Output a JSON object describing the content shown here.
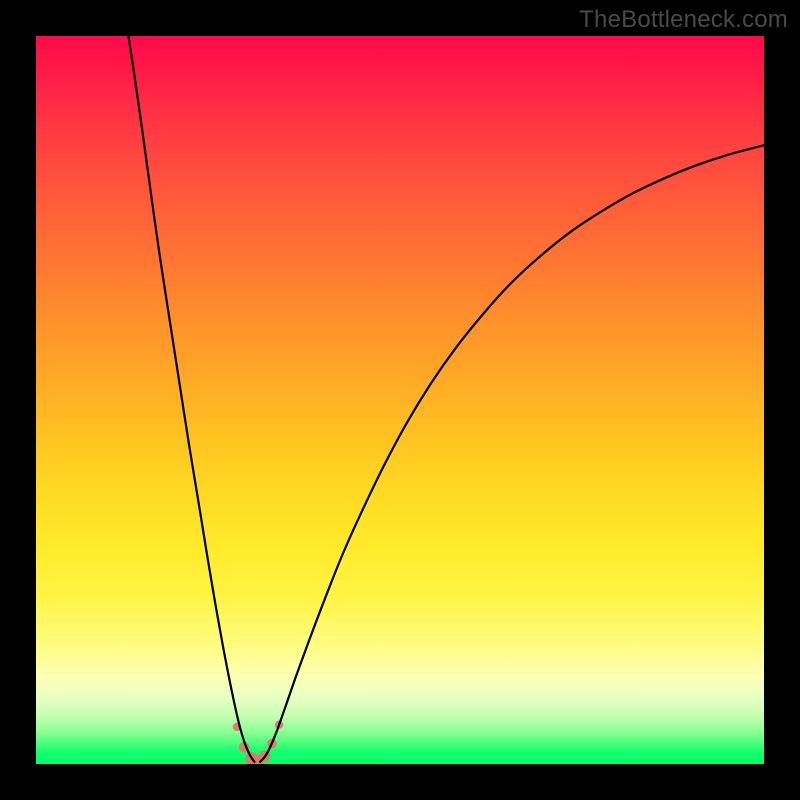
{
  "watermark": "TheBottleneck.com",
  "colors": {
    "frame": "#000000",
    "curve_stroke": "#000000",
    "marker_fill": "#e57368",
    "marker_stroke": "#e57368"
  },
  "chart_data": {
    "type": "line",
    "title": "",
    "xlabel": "",
    "ylabel": "",
    "xlim": [
      0,
      100
    ],
    "ylim": [
      0,
      100
    ],
    "grid": false,
    "legend": false,
    "curve_left": {
      "description": "steep descending arc from near top-left to valley",
      "points": [
        {
          "x": 12.7,
          "y": 100.0
        },
        {
          "x": 13.6,
          "y": 94.0
        },
        {
          "x": 14.6,
          "y": 87.0
        },
        {
          "x": 15.7,
          "y": 79.0
        },
        {
          "x": 16.9,
          "y": 70.5
        },
        {
          "x": 18.2,
          "y": 62.0
        },
        {
          "x": 19.6,
          "y": 53.0
        },
        {
          "x": 21.0,
          "y": 44.0
        },
        {
          "x": 22.4,
          "y": 35.5
        },
        {
          "x": 23.7,
          "y": 27.5
        },
        {
          "x": 24.9,
          "y": 20.5
        },
        {
          "x": 26.0,
          "y": 14.5
        },
        {
          "x": 27.0,
          "y": 9.5
        },
        {
          "x": 27.9,
          "y": 5.5
        },
        {
          "x": 28.7,
          "y": 2.8
        },
        {
          "x": 29.4,
          "y": 1.2
        },
        {
          "x": 30.0,
          "y": 0.3
        }
      ]
    },
    "curve_right": {
      "description": "rising arc from valley toward upper-right, flattening",
      "points": [
        {
          "x": 30.8,
          "y": 0.3
        },
        {
          "x": 31.7,
          "y": 1.4
        },
        {
          "x": 32.8,
          "y": 3.8
        },
        {
          "x": 34.1,
          "y": 7.4
        },
        {
          "x": 35.7,
          "y": 12.0
        },
        {
          "x": 37.6,
          "y": 17.2
        },
        {
          "x": 39.8,
          "y": 23.0
        },
        {
          "x": 42.2,
          "y": 29.0
        },
        {
          "x": 44.9,
          "y": 35.0
        },
        {
          "x": 47.8,
          "y": 41.0
        },
        {
          "x": 50.9,
          "y": 46.8
        },
        {
          "x": 54.2,
          "y": 52.2
        },
        {
          "x": 57.7,
          "y": 57.2
        },
        {
          "x": 61.4,
          "y": 61.8
        },
        {
          "x": 65.2,
          "y": 66.0
        },
        {
          "x": 69.2,
          "y": 69.7
        },
        {
          "x": 73.3,
          "y": 73.0
        },
        {
          "x": 77.5,
          "y": 75.8
        },
        {
          "x": 81.8,
          "y": 78.3
        },
        {
          "x": 86.2,
          "y": 80.4
        },
        {
          "x": 90.6,
          "y": 82.2
        },
        {
          "x": 95.1,
          "y": 83.7
        },
        {
          "x": 100.0,
          "y": 85.0
        }
      ]
    },
    "markers": [
      {
        "x": 27.6,
        "y": 5.1,
        "r": 4.2
      },
      {
        "x": 28.6,
        "y": 2.3,
        "r": 5.3
      },
      {
        "x": 29.6,
        "y": 0.8,
        "r": 6.2
      },
      {
        "x": 30.4,
        "y": 0.4,
        "r": 6.2
      },
      {
        "x": 31.4,
        "y": 1.1,
        "r": 5.6
      },
      {
        "x": 32.4,
        "y": 2.8,
        "r": 4.8
      },
      {
        "x": 33.4,
        "y": 5.4,
        "r": 4.2
      }
    ]
  }
}
